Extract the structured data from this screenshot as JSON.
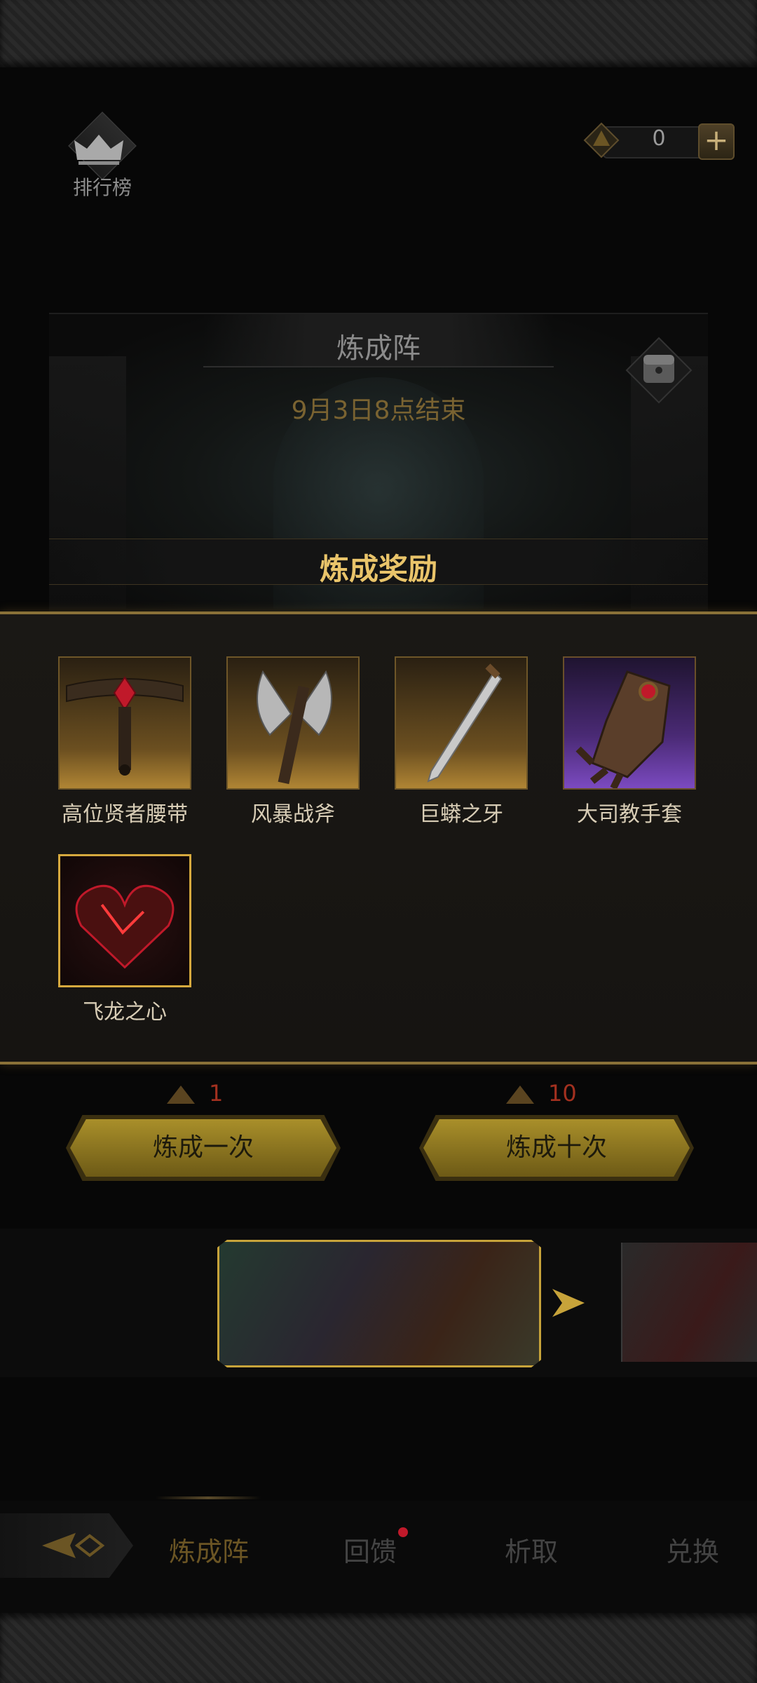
{
  "top_left": {
    "rank_label": "排行榜"
  },
  "currency": {
    "value": "0",
    "plus": "+"
  },
  "hero": {
    "title": "炼成阵",
    "subtitle": "9月3日8点结束",
    "reward_title": "炼成奖励"
  },
  "rewards": [
    {
      "name": "高位贤者腰带",
      "icon": "belt-icon",
      "rarity": "gold"
    },
    {
      "name": "风暴战斧",
      "icon": "axe-icon",
      "rarity": "gold"
    },
    {
      "name": "巨蟒之牙",
      "icon": "dagger-icon",
      "rarity": "gold"
    },
    {
      "name": "大司教手套",
      "icon": "gauntlet-icon",
      "rarity": "purple"
    },
    {
      "name": "飞龙之心",
      "icon": "dragon-heart-icon",
      "rarity": "legendary"
    }
  ],
  "actions": {
    "once": {
      "cost": "1",
      "label": "炼成一次"
    },
    "ten": {
      "cost": "10",
      "label": "炼成十次"
    }
  },
  "tabs": [
    {
      "label": "炼成阵",
      "active": true
    },
    {
      "label": "回馈",
      "badge": true
    },
    {
      "label": "析取"
    },
    {
      "label": "兑换"
    }
  ],
  "colors": {
    "accent_gold": "#e9c46a",
    "cost_red": "#a2301f",
    "badge_red": "#c0192a"
  }
}
